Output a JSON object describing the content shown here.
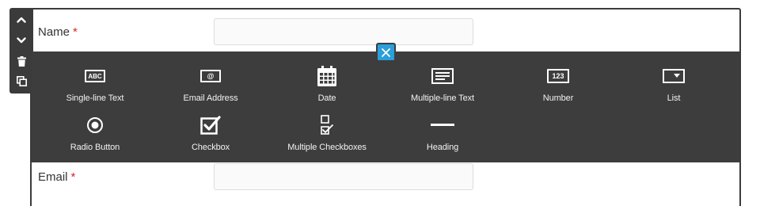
{
  "form": {
    "fields": [
      {
        "label": "Name",
        "required_mark": "*",
        "value": "",
        "placeholder": ""
      },
      {
        "label": "Email",
        "required_mark": "*",
        "value": "",
        "placeholder": ""
      }
    ]
  },
  "toolbar": {
    "items": [
      {
        "icon": "chevron-up-icon",
        "action": "move-up"
      },
      {
        "icon": "chevron-down-icon",
        "action": "move-down"
      },
      {
        "icon": "trash-icon",
        "action": "delete"
      },
      {
        "icon": "copy-icon",
        "action": "duplicate"
      }
    ]
  },
  "picker": {
    "close_icon": "close-icon",
    "accent_color": "#2a9fdb",
    "items": [
      {
        "label": "Single-line Text",
        "icon": "single-line-text-icon",
        "icon_text": "ABC"
      },
      {
        "label": "Email Address",
        "icon": "email-icon",
        "icon_text": "@"
      },
      {
        "label": "Date",
        "icon": "calendar-icon"
      },
      {
        "label": "Multiple-line Text",
        "icon": "multiline-text-icon"
      },
      {
        "label": "Number",
        "icon": "number-icon",
        "icon_text": "123"
      },
      {
        "label": "List",
        "icon": "dropdown-list-icon"
      },
      {
        "label": "Radio Button",
        "icon": "radio-button-icon"
      },
      {
        "label": "Checkbox",
        "icon": "checkbox-icon"
      },
      {
        "label": "Multiple Checkboxes",
        "icon": "multiple-checkboxes-icon"
      },
      {
        "label": "Heading",
        "icon": "heading-icon"
      }
    ]
  }
}
